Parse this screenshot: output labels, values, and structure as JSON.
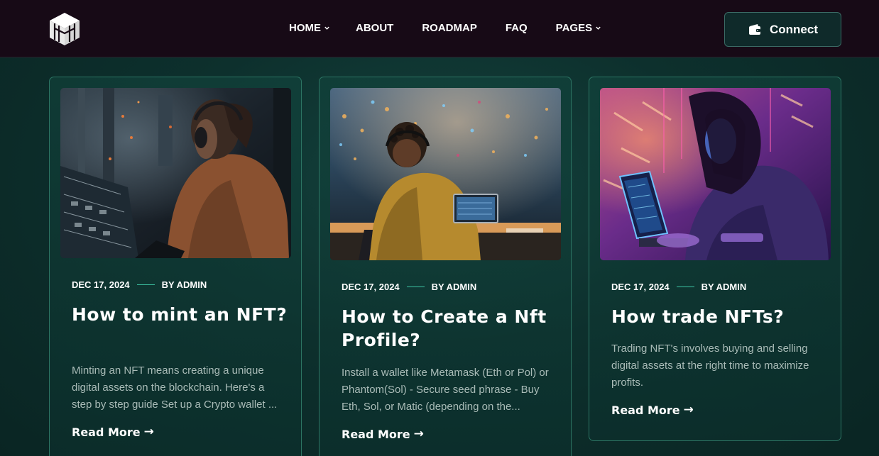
{
  "nav": {
    "items": [
      {
        "label": "HOME",
        "dropdown": true
      },
      {
        "label": "ABOUT",
        "dropdown": false
      },
      {
        "label": "ROADMAP",
        "dropdown": false
      },
      {
        "label": "FAQ",
        "dropdown": false
      },
      {
        "label": "PAGES",
        "dropdown": true
      }
    ],
    "connect_label": "Connect",
    "connect_icon": "wallet-icon",
    "logo_icon": "cube-logo-icon"
  },
  "posts": [
    {
      "date": "DEC 17, 2024",
      "author": "BY ADMIN",
      "title": "How to mint an NFT?",
      "excerpt": "Minting an NFT means creating a unique digital assets on the blockchain. Here's a step by step guide Set up a Crypto wallet ...",
      "read_more": "Read More",
      "image": "woman with headphones at futuristic console"
    },
    {
      "date": "DEC 17, 2024",
      "author": "BY ADMIN",
      "title": "How to Create a Nft Profile?",
      "excerpt": "Install a wallet like Metamask (Eth or Pol) or Phantom(Sol) - Secure seed phrase - Buy Eth, Sol, or Matic (depending on the...",
      "read_more": "Read More",
      "image": "person with headphones at laptop in neon hall"
    },
    {
      "date": "DEC 17, 2024",
      "author": "BY ADMIN",
      "title": "How trade NFTs?",
      "excerpt": "Trading NFT's involves buying and selling digital assets at the right time to maximize profits.",
      "read_more": "Read More",
      "image": "person typing on laptop under purple neon light"
    }
  ],
  "colors": {
    "nav_bg": "#170a16",
    "page_bg": "#0d302d",
    "card_border": "#2c7463",
    "accent": "#3cc2a2"
  }
}
